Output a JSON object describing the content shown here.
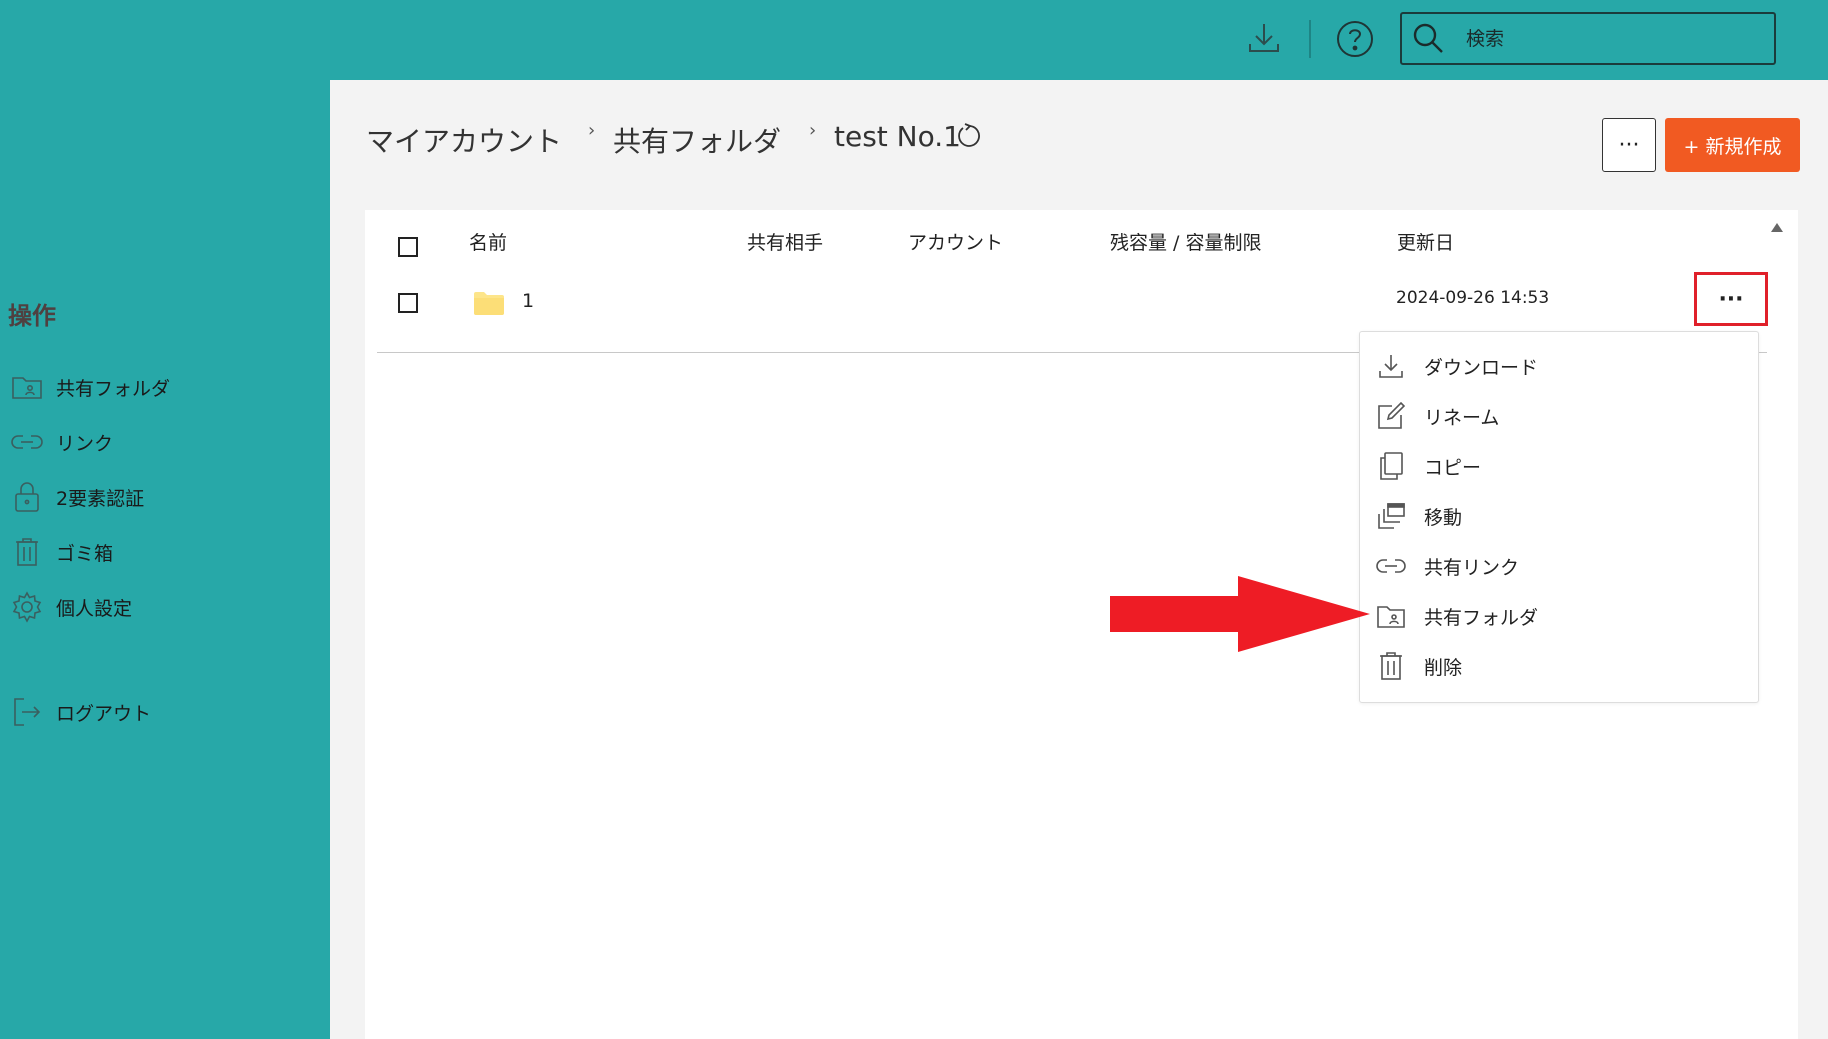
{
  "topbar": {
    "search_placeholder": "検索"
  },
  "sidebar": {
    "heading": "操作",
    "items": [
      {
        "label": "共有フォルダ",
        "icon": "shared-folder-icon"
      },
      {
        "label": "リンク",
        "icon": "link-icon"
      },
      {
        "label": "2要素認証",
        "icon": "lock-icon"
      },
      {
        "label": "ゴミ箱",
        "icon": "trash-icon"
      },
      {
        "label": "個人設定",
        "icon": "gear-icon"
      }
    ],
    "logout_label": "ログアウト"
  },
  "breadcrumb": {
    "items": [
      "マイアカウント",
      "共有フォルダ",
      "test No.1"
    ],
    "separator": "›"
  },
  "actions": {
    "more_label": "···",
    "new_label": "+ 新規作成",
    "new_color": "#f15a22"
  },
  "table": {
    "headers": [
      "名前",
      "共有相手",
      "アカウント",
      "残容量 / 容量制限",
      "更新日"
    ],
    "rows": [
      {
        "name": "1",
        "updated": "2024-09-26 14:53",
        "type": "folder"
      }
    ],
    "row_more_label": "···"
  },
  "menu": {
    "items": [
      {
        "label": "ダウンロード",
        "icon": "download-icon"
      },
      {
        "label": "リネーム",
        "icon": "rename-icon"
      },
      {
        "label": "コピー",
        "icon": "copy-icon"
      },
      {
        "label": "移動",
        "icon": "move-icon"
      },
      {
        "label": "共有リンク",
        "icon": "link-icon"
      },
      {
        "label": "共有フォルダ",
        "icon": "shared-folder-icon"
      },
      {
        "label": "削除",
        "icon": "trash-icon"
      }
    ]
  },
  "colors": {
    "teal": "#27a8a8",
    "panel": "#f3f3f3",
    "highlight_red": "#e0202a",
    "arrow_red": "#ee1c25"
  }
}
